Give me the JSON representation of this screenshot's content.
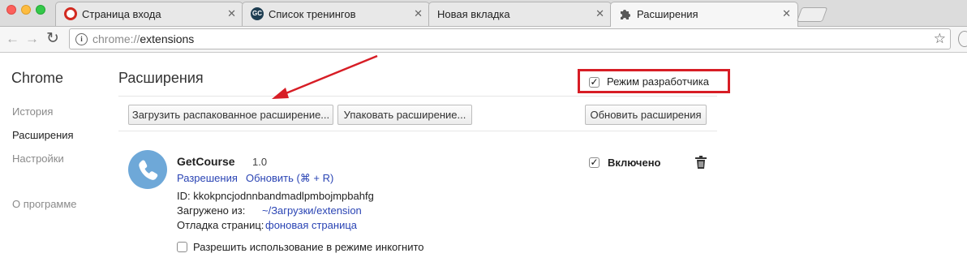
{
  "tabs": [
    {
      "title": "Страница входа",
      "icon": "red-circle-icon"
    },
    {
      "title": "Список тренингов",
      "icon": "gc-logo-icon",
      "icon_text": "GC"
    },
    {
      "title": "Новая вкладка",
      "icon": ""
    },
    {
      "title": "Расширения",
      "icon": "puzzle-icon",
      "active": true
    }
  ],
  "omnibox": {
    "scheme": "chrome://",
    "host": "extensions"
  },
  "sidebar": {
    "title": "Chrome",
    "items": [
      "История",
      "Расширения",
      "Настройки",
      "О программе"
    ],
    "selected": "Расширения"
  },
  "main": {
    "title": "Расширения",
    "developer_mode": {
      "label": "Режим разработчика",
      "checked": true
    },
    "buttons": {
      "load_unpacked": "Загрузить распакованное расширение...",
      "pack": "Упаковать расширение...",
      "update": "Обновить расширения"
    }
  },
  "extension": {
    "name": "GetCourse",
    "version": "1.0",
    "permissions_link": "Разрешения",
    "reload_link": "Обновить (⌘ + R)",
    "id_line": "ID: kkokpncjodnnbandmadlpmbojmpbahfg",
    "loaded_from_label": "Загружено из:",
    "loaded_from_path": "~/Загрузки/extension",
    "inspect_label": "Отладка страниц:",
    "inspect_link": "фоновая страница",
    "incognito_label": "Разрешить использование в режиме инкогнито",
    "incognito_checked": false,
    "enabled_label": "Включено",
    "enabled_checked": true
  },
  "colors": {
    "highlight": "#d71d25",
    "link": "#2a44b4",
    "ext_icon_bg": "#6ea8d8"
  }
}
